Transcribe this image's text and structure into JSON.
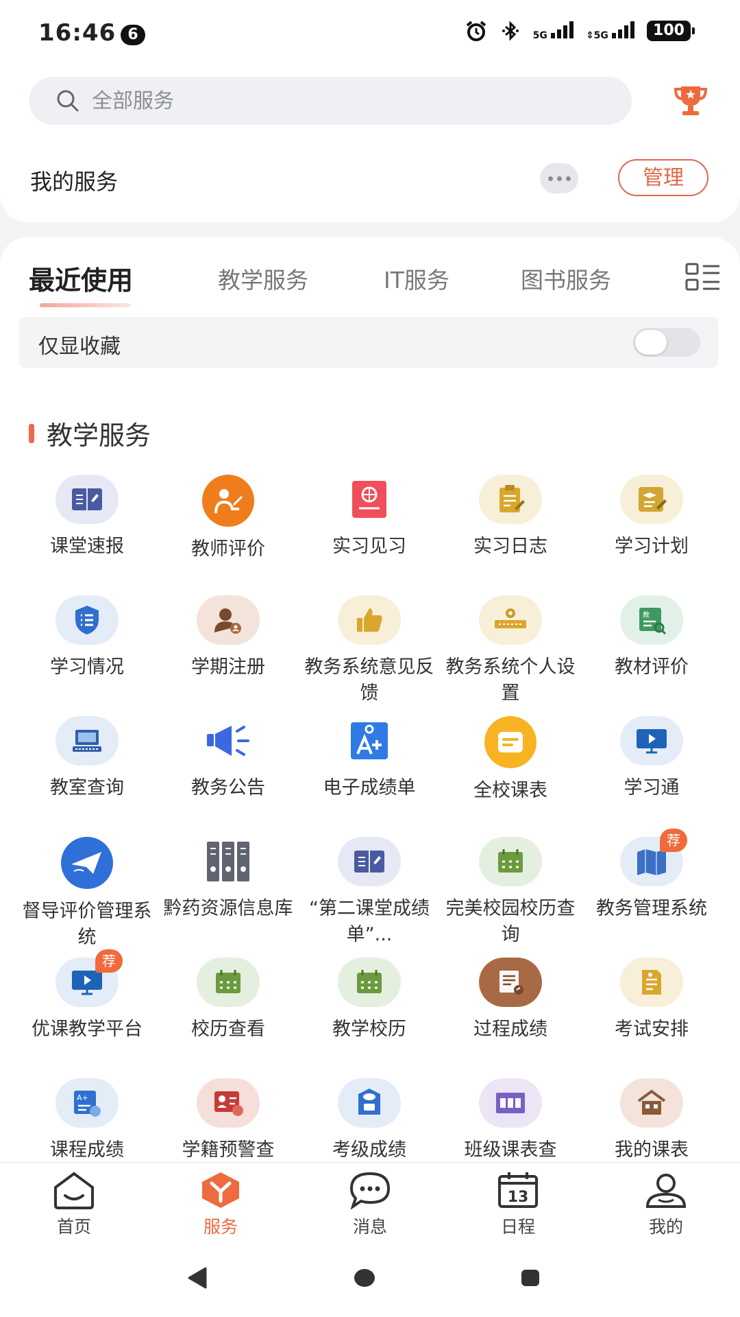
{
  "status_bar": {
    "time": "16:46",
    "notification_count": "6",
    "signal1": "5G",
    "signal2": "5G",
    "battery": "100"
  },
  "search": {
    "placeholder": "全部服务"
  },
  "my_services": {
    "title": "我的服务",
    "manage_label": "管理"
  },
  "tabs": [
    {
      "label": "最近使用",
      "active": true
    },
    {
      "label": "教学服务",
      "active": false
    },
    {
      "label": "IT服务",
      "active": false
    },
    {
      "label": "图书服务",
      "active": false
    }
  ],
  "favorites_toggle": {
    "label": "仅显收藏",
    "on": false
  },
  "section": {
    "title": "教学服务"
  },
  "services": [
    {
      "label": "课堂速报",
      "icon": "book-report-icon"
    },
    {
      "label": "教师评价",
      "icon": "teacher-icon"
    },
    {
      "label": "实习见习",
      "icon": "internship-icon"
    },
    {
      "label": "实习日志",
      "icon": "clipboard-log-icon"
    },
    {
      "label": "学习计划",
      "icon": "study-plan-icon"
    },
    {
      "label": "学习情况",
      "icon": "shield-list-icon"
    },
    {
      "label": "学期注册",
      "icon": "user-register-icon"
    },
    {
      "label": "教务系统意见反馈",
      "icon": "thumbs-up-icon"
    },
    {
      "label": "教务系统个人设置",
      "icon": "settings-machine-icon"
    },
    {
      "label": "教材评价",
      "icon": "textbook-search-icon"
    },
    {
      "label": "教室查询",
      "icon": "computer-icon"
    },
    {
      "label": "教务公告",
      "icon": "megaphone-icon"
    },
    {
      "label": "电子成绩单",
      "icon": "grade-a-plus-icon"
    },
    {
      "label": "全校课表",
      "icon": "message-card-icon"
    },
    {
      "label": "学习通",
      "icon": "video-screen-icon"
    },
    {
      "label": "督导评价管理系统",
      "icon": "paper-plane-icon"
    },
    {
      "label": "黔药资源信息库",
      "icon": "binders-icon"
    },
    {
      "label": "“第二课堂成绩单”...",
      "icon": "book-report-icon"
    },
    {
      "label": "完美校园校历查询",
      "icon": "calendar-icon"
    },
    {
      "label": "教务管理系统",
      "icon": "map-book-icon",
      "badge": "荐"
    },
    {
      "label": "优课教学平台",
      "icon": "video-screen-icon",
      "badge": "荐"
    },
    {
      "label": "校历查看",
      "icon": "calendar-icon"
    },
    {
      "label": "教学校历",
      "icon": "calendar-icon"
    },
    {
      "label": "过程成绩",
      "icon": "document-brown-icon"
    },
    {
      "label": "考试安排",
      "icon": "exam-note-icon"
    },
    {
      "label": "课程成绩",
      "icon": "course-grade-icon"
    },
    {
      "label": "学籍预警查",
      "icon": "student-warning-icon"
    },
    {
      "label": "考级成绩",
      "icon": "exam-level-icon"
    },
    {
      "label": "班级课表查",
      "icon": "class-schedule-icon"
    },
    {
      "label": "我的课表",
      "icon": "house-schedule-icon"
    }
  ],
  "bottom_nav": [
    {
      "label": "首页",
      "icon": "home-icon",
      "active": false
    },
    {
      "label": "服务",
      "icon": "service-icon",
      "active": true
    },
    {
      "label": "消息",
      "icon": "message-icon",
      "active": false
    },
    {
      "label": "日程",
      "icon": "calendar-13-icon",
      "active": false,
      "day": "13"
    },
    {
      "label": "我的",
      "icon": "profile-icon",
      "active": false
    }
  ],
  "colors": {
    "accent": "#ef6a3e",
    "section_bar": "#ec6a4f"
  }
}
